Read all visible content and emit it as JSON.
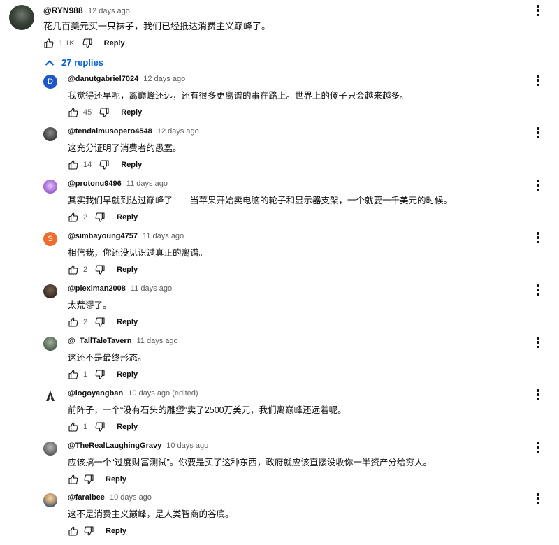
{
  "top_comment": {
    "handle": "@RYN988",
    "time": "12 days ago",
    "text": "花几百美元买一只袜子，我们已经抵达消费主义巅峰了。",
    "likes": "1.1K",
    "reply_label": "Reply",
    "avatar_icon": "avatar-photo"
  },
  "replies_toggle": {
    "label": "27 replies",
    "icon": "chevron-up-icon",
    "color": "#065fd4"
  },
  "replies": [
    {
      "handle": "@danutgabriel7024",
      "time": "12 days ago",
      "text": "我觉得还早呢，离巅峰还远，还有很多更离谱的事在路上。世界上的傻子只会越来越多。",
      "likes": "45",
      "reply_label": "Reply",
      "avatar_letter": "D",
      "avatar_color": "#1e57c7"
    },
    {
      "handle": "@tendaimusopero4548",
      "time": "12 days ago",
      "text": "这充分证明了消费者的愚蠢。",
      "likes": "14",
      "reply_label": "Reply",
      "avatar_letter": "",
      "avatar_color": "#4a4a4a"
    },
    {
      "handle": "@protonu9496",
      "time": "11 days ago",
      "text": "其实我们早就到达过巅峰了——当苹果开始卖电脑的轮子和显示器支架，一个就要一千美元的时候。",
      "likes": "2",
      "reply_label": "Reply",
      "avatar_letter": "",
      "avatar_color": "#a66ad8"
    },
    {
      "handle": "@simbayoung4757",
      "time": "11 days ago",
      "text": "相信我，你还没见识过真正的离谱。",
      "likes": "2",
      "reply_label": "Reply",
      "avatar_letter": "S",
      "avatar_color": "#ef6c2c"
    },
    {
      "handle": "@pleximan2008",
      "time": "11 days ago",
      "text": "太荒谬了。",
      "likes": "2",
      "reply_label": "Reply",
      "avatar_letter": "",
      "avatar_color": "#3b2f28"
    },
    {
      "handle": "@_TallTaleTavern",
      "time": "11 days ago",
      "text": "这还不是最终形态。",
      "likes": "1",
      "reply_label": "Reply",
      "avatar_letter": "",
      "avatar_color": "#5b6e5a"
    },
    {
      "handle": "@logoyangban",
      "time": "10 days ago (edited)",
      "text": "前阵子，一个“没有石头的雕塑”卖了2500万美元，我们离巅峰还远着呢。",
      "likes": "1",
      "reply_label": "Reply",
      "avatar_letter": "",
      "avatar_color": "#ffffff"
    },
    {
      "handle": "@TheRealLaughingGravy",
      "time": "10 days ago",
      "text": "应该搞一个“过度财富测试”。你要是买了这种东西，政府就应该直接没收你一半资产分给穷人。",
      "likes": "",
      "reply_label": "Reply",
      "avatar_letter": "",
      "avatar_color": "#6b6b6b"
    },
    {
      "handle": "@faraibee",
      "time": "10 days ago",
      "text": "这不是消费主义巅峰，是人类智商的谷底。",
      "likes": "",
      "reply_label": "Reply",
      "avatar_letter": "",
      "avatar_color": "#3d5a80"
    }
  ],
  "icons": {
    "like": "thumbs-up-icon",
    "dislike": "thumbs-down-icon",
    "menu": "more-vert-icon"
  }
}
